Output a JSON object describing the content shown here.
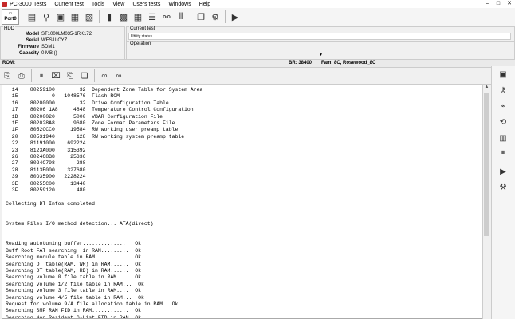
{
  "window": {
    "title": "PC-3000",
    "controls": [
      "–",
      "□",
      "✕"
    ]
  },
  "menu": [
    "Tests",
    "Current test",
    "Tools",
    "View",
    "Users tests",
    "Windows",
    "Help"
  ],
  "toolbar": {
    "port_label": "Port0",
    "icons": [
      "hdd-icon",
      "search-icon",
      "drive-id-icon",
      "sd-icon",
      "dbd-icon",
      "bay-icon",
      "chip-icon",
      "grid-icon",
      "list-icon",
      "network-icon",
      "columns-icon",
      "copy-icon",
      "settings-icon",
      "play-icon"
    ]
  },
  "hdd": {
    "legend": "HDD",
    "fields": [
      {
        "label": "Model",
        "value": "ST1000LM035-1RK172"
      },
      {
        "label": "Serial",
        "value": "WES1LCYZ"
      },
      {
        "label": "Firmware",
        "value": "SDM1"
      },
      {
        "label": "Capacity",
        "value": "0 MB ()"
      }
    ]
  },
  "current_test": {
    "legend": "Current test",
    "value": "Utility status"
  },
  "operation": {
    "legend": "Operation"
  },
  "status": {
    "rom": "ROM:",
    "br": "BR: 38400",
    "fam": "Fam: 8C, Rosewood_8C"
  },
  "console": {
    "lines": [
      "  14    80259100        32  Dependent Zone Table for System Area",
      "  15           0   1048576  Flash ROM",
      "  16    80200000        32  Drive Configuration Table",
      "  17    80206 1A8     4848  Temperature Control Configuration",
      "  1D    80200020      5000  VBAR Configuration File",
      "  1E    802028A8      9680  Zone Format Parameters File",
      "  1F    8052CCC0     19584  RW working user preamp table",
      "  20    80531940       128  RW working system preamp table",
      "  22    81191000    692224",
      "  23    8123A000    315392",
      "  26    8024C8B8     25336",
      "  27    8024C798       288",
      "  28    8113E000    327680",
      "  39    80D35900   2228224",
      "  3E    80255C00     13440",
      "  3F    80259120       480",
      "",
      "Collecting DT Infos completed",
      "",
      "",
      "System Files I/O method detection... ATA(direct)",
      "",
      "",
      "Reading autotuning buffer..............   Ok",
      "Buff Root FAT searching  in RAM.........  Ok",
      "Searching module table in RAM... .......  Ok",
      "Searching DT table(RAM, WR) in RAM......  Ok",
      "Searching DT table(RAM, RD) in RAM......  Ok",
      "Searching volume 0 file table in RAM....  Ok",
      "Searching volume 1/2 file table in RAM...  Ok",
      "Searching volume 3 file table in RAM....  Ok",
      "Searching volume 4/5 file table in RAM...  Ok",
      "Request for volume 9/A file allocation table in RAM   Ok",
      "Searching SMP RAM FID in RAM............  Ok",
      "Searching Non Resident G-List FID in RAM  Ok"
    ]
  }
}
